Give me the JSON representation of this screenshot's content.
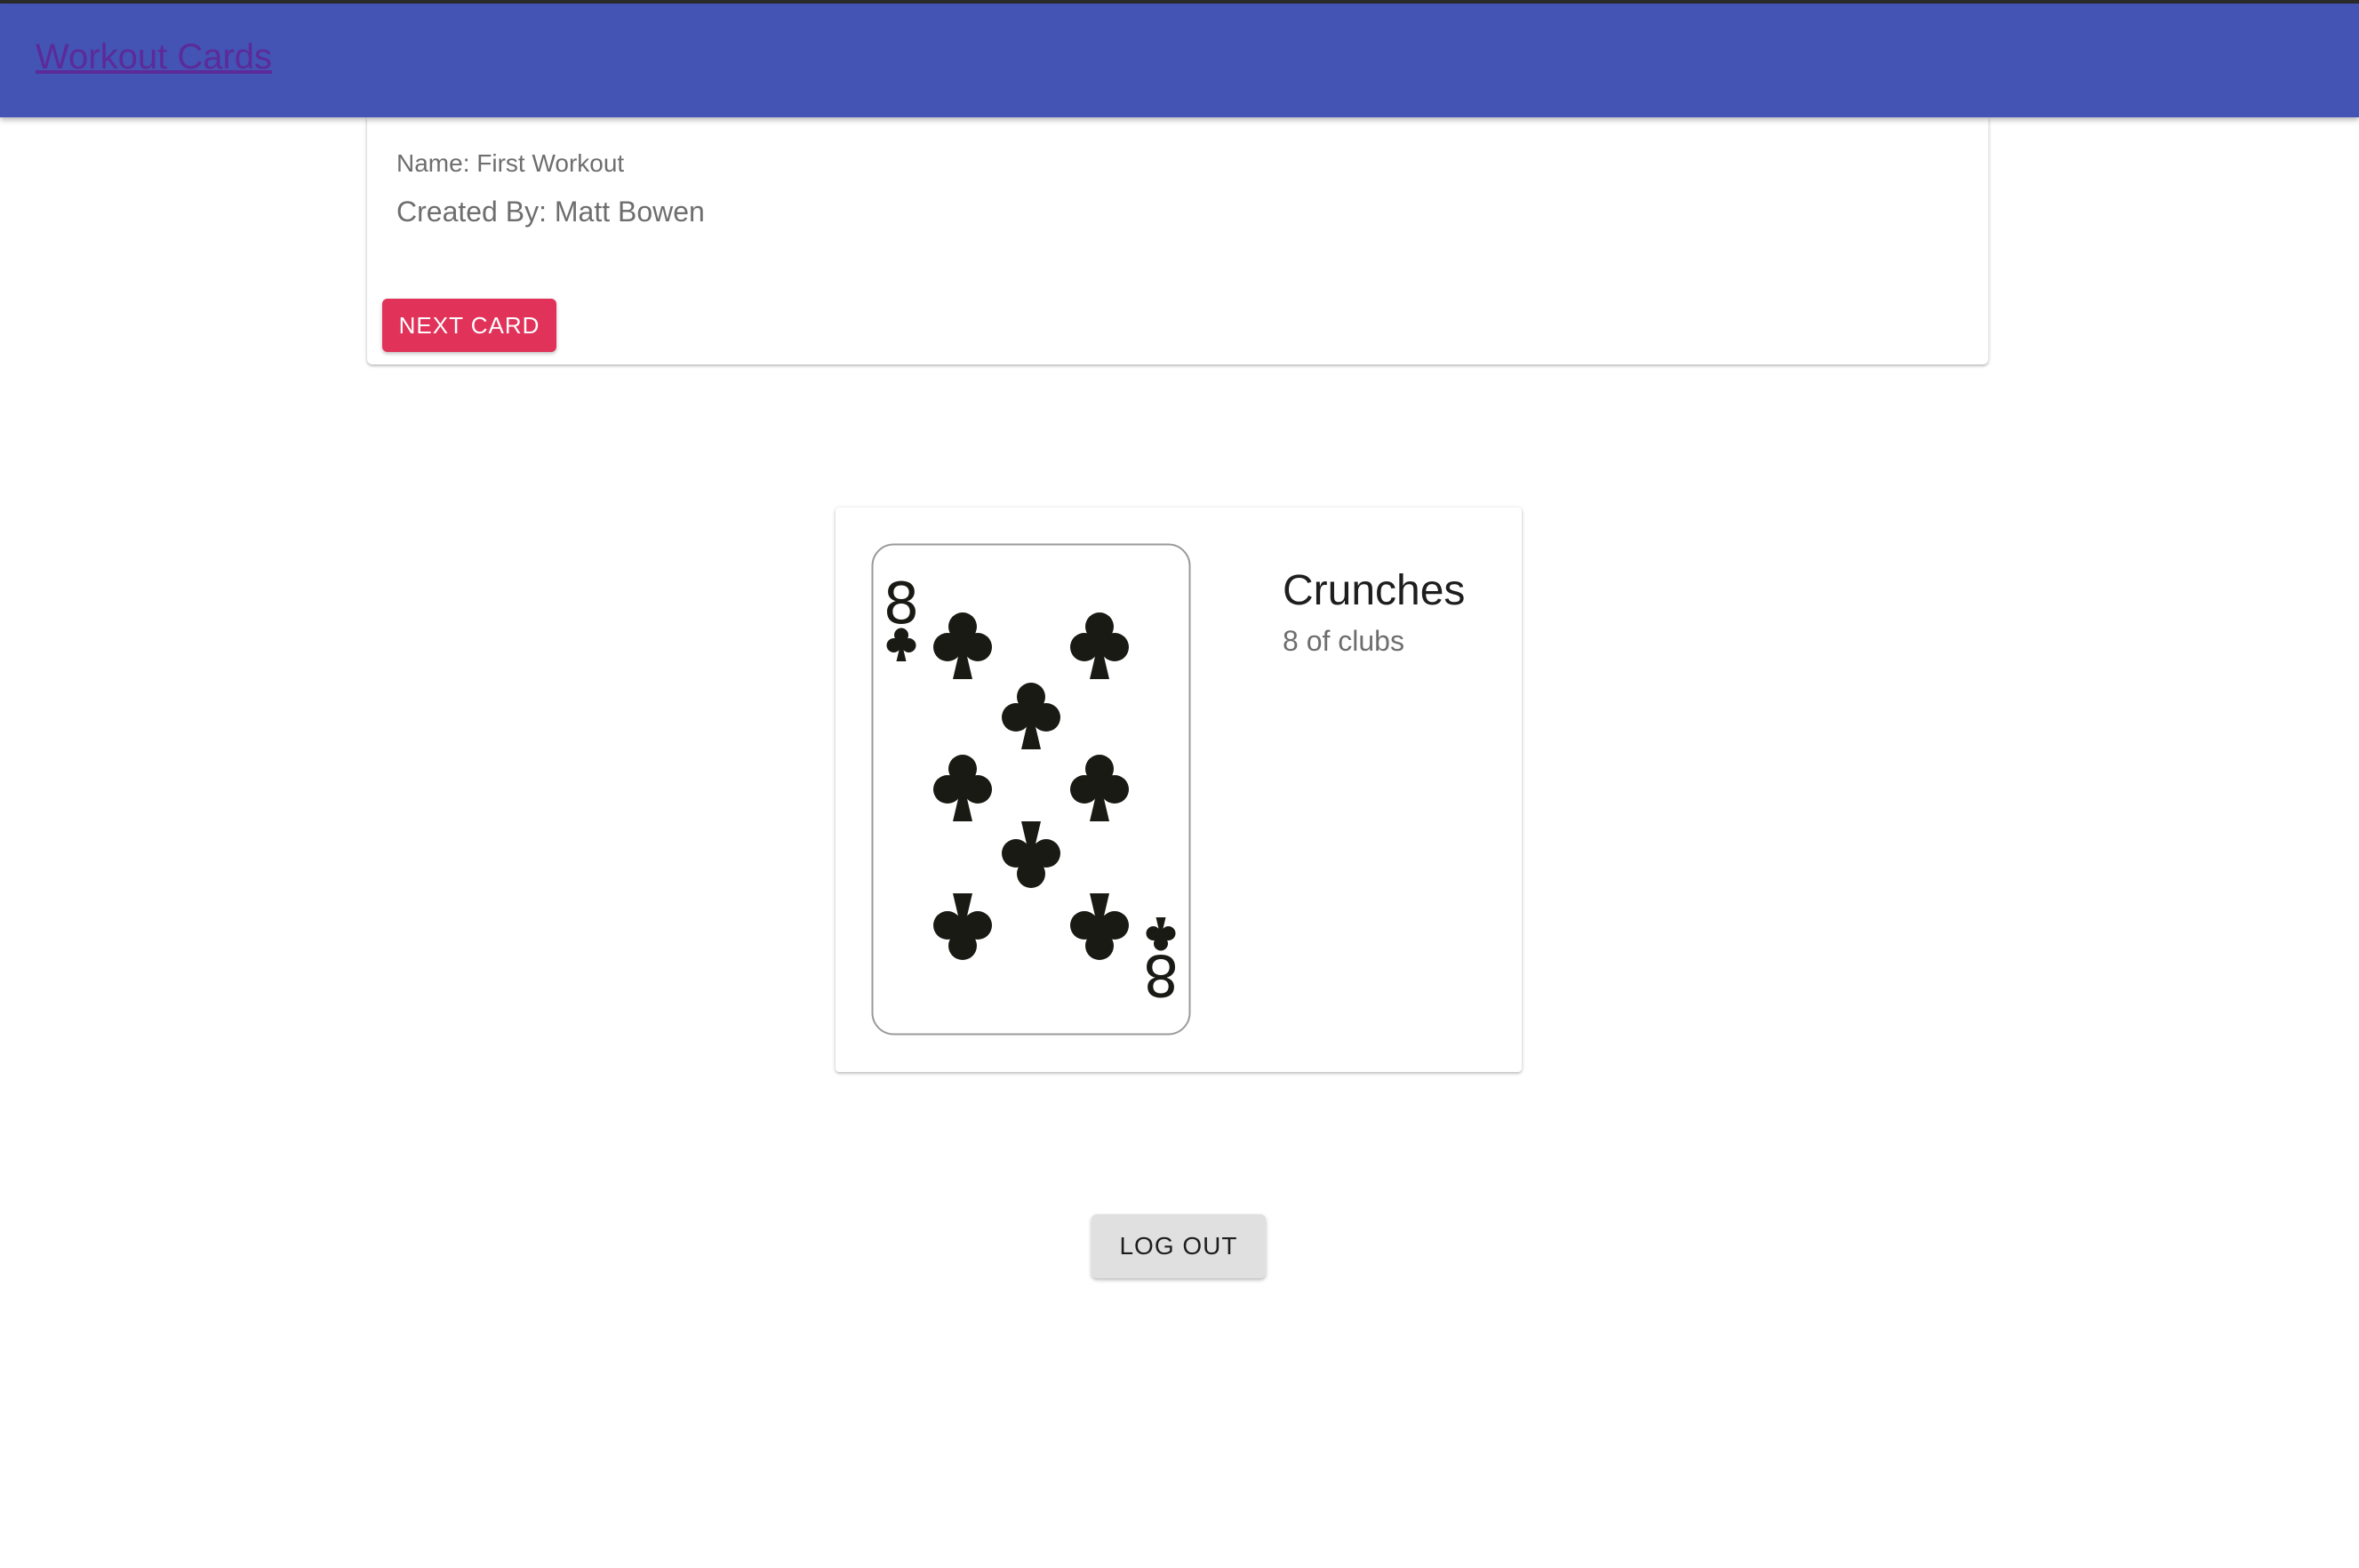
{
  "app": {
    "title": "Workout Cards"
  },
  "workout": {
    "name_text": "Name: First Workout",
    "created_by_text": "Created By: Matt Bowen",
    "next_label": "NEXT CARD"
  },
  "current_card": {
    "exercise": "Crunches",
    "description": "8 of clubs",
    "rank": "8",
    "suit": "clubs",
    "suit_icon": "club-icon",
    "pip_count": 8
  },
  "logout_label": "LOG OUT",
  "colors": {
    "appbar": "#4354b4",
    "title_link": "#5c2a99",
    "next_button": "#e1325a",
    "logout_button": "#e0e0e0",
    "card_ink": "#1a1a14"
  }
}
